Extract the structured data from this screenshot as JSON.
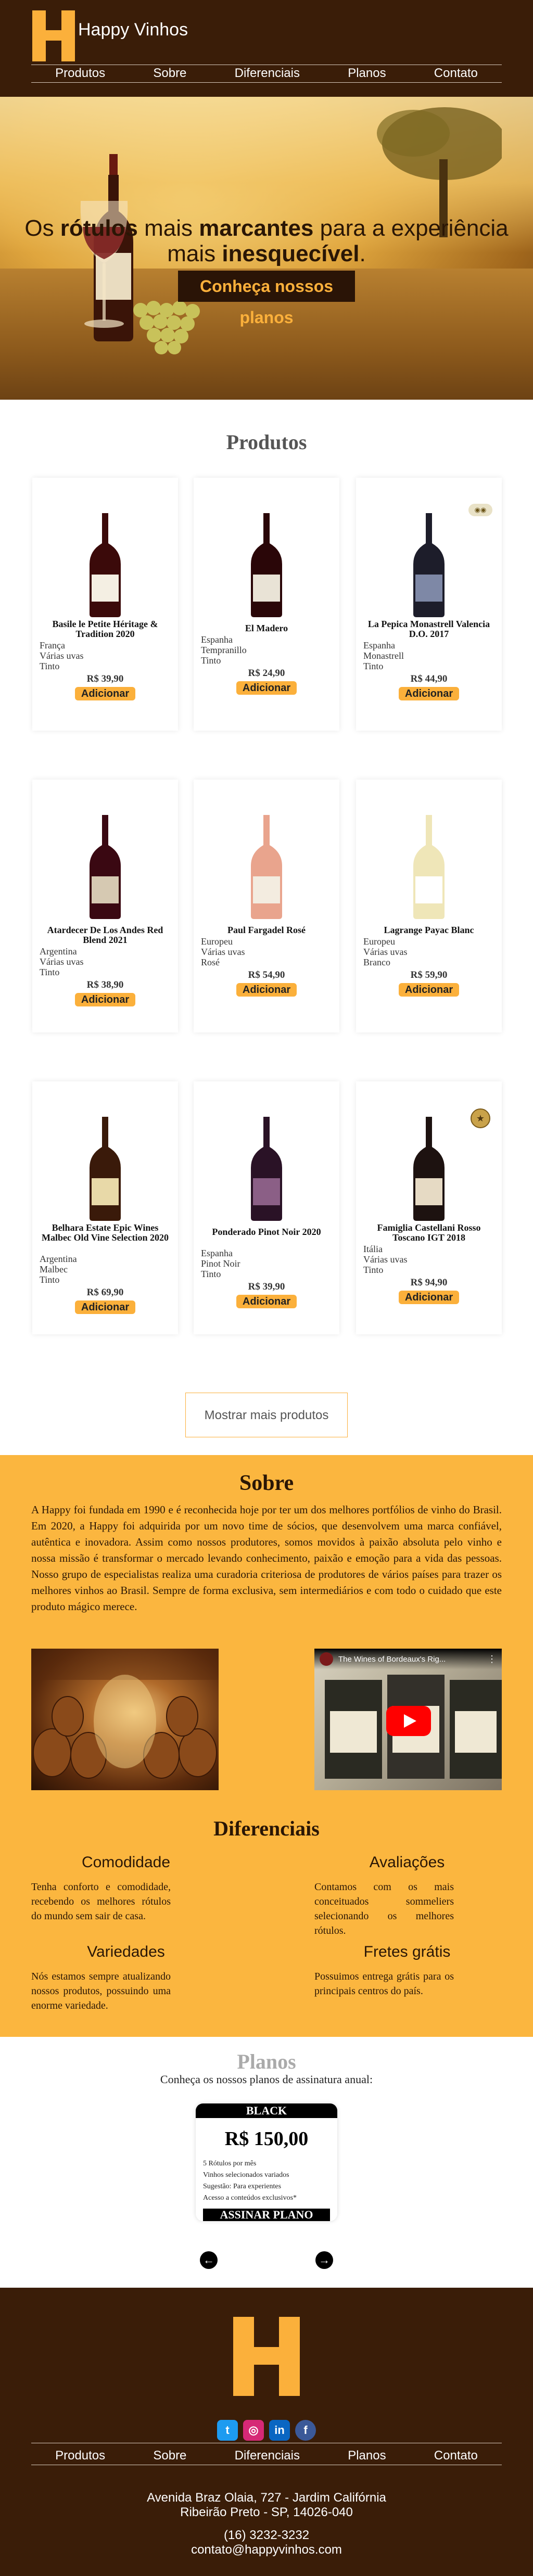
{
  "brand": {
    "name": "Happy Vinhos",
    "accent": "#fbb03b",
    "dark": "#3a1d08"
  },
  "nav": [
    "Produtos",
    "Sobre",
    "Diferenciais",
    "Planos",
    "Contato"
  ],
  "hero": {
    "line1_pre": "Os ",
    "line1_b1": "rótulos",
    "line1_mid": " mais ",
    "line1_b2": "marcantes",
    "line1_post": " para a experiência",
    "line2_pre": "mais ",
    "line2_b": "inesquecível",
    "line2_post": ".",
    "button": "Conheça nossos planos"
  },
  "products": {
    "title": "Produtos",
    "add_label": "Adicionar",
    "items": [
      {
        "name": "Basile le Petite Héritage & Tradition 2020",
        "country": "França",
        "grape": "Várias uvas",
        "type": "Tinto",
        "price": "R$ 39,90",
        "bottle": "#3b0a0a",
        "label": "#f4efe3"
      },
      {
        "name": "El Madero",
        "country": "Espanha",
        "grape": "Tempranillo",
        "type": "Tinto",
        "price": "R$ 24,90",
        "bottle": "#2a0608",
        "label": "#e9e3d6"
      },
      {
        "name": "La Pepica Monastrell Valencia D.O. 2017",
        "country": "Espanha",
        "grape": "Monastrell",
        "type": "Tinto",
        "price": "R$ 44,90",
        "bottle": "#1d1d2a",
        "label": "#7e88a6",
        "badge": "pill"
      },
      {
        "name": "Atardecer De Los Andes Red Blend 2021",
        "country": "Argentina",
        "grape": "Várias uvas",
        "type": "Tinto",
        "price": "R$ 38,90",
        "bottle": "#3a0812",
        "label": "#d6c9b2"
      },
      {
        "name": "Paul Fargadel Rosé",
        "country": "Europeu",
        "grape": "Várias uvas",
        "type": "Rosé",
        "price": "R$ 54,90",
        "bottle": "#e9a48d",
        "label": "#f3ece0"
      },
      {
        "name": "Lagrange Payac Blanc",
        "country": "Europeu",
        "grape": "Várias uvas",
        "type": "Branco",
        "price": "R$ 59,90",
        "bottle": "#efe6b8",
        "label": "#ffffff"
      },
      {
        "name": "Belhara Estate Epic Wines Malbec Old Vine Selection 2020",
        "country": "Argentina",
        "grape": "Malbec",
        "type": "Tinto",
        "price": "R$ 69,90",
        "bottle": "#3a1a0a",
        "label": "#e8d9a8"
      },
      {
        "name": "Ponderado Pinot Noir 2020",
        "country": "Espanha",
        "grape": "Pinot Noir",
        "type": "Tinto",
        "price": "R$ 39,90",
        "bottle": "#2a1226",
        "label": "#8b5f86"
      },
      {
        "name": "Famiglia Castellani Rosso Toscano IGT 2018",
        "country": "Itália",
        "grape": "Várias uvas",
        "type": "Tinto",
        "price": "R$ 94,90",
        "bottle": "#1d1210",
        "label": "#e6dac4",
        "badge": "medal"
      }
    ],
    "more_button": "Mostrar mais produtos"
  },
  "sobre": {
    "title": "Sobre",
    "text": "A Happy foi fundada em 1990 e é reconhecida hoje por ter um dos melhores portfólios de vinho do Brasil. Em 2020, a Happy foi adquirida por um novo time de sócios, que desenvolvem uma marca confiável, autêntica e inovadora. Assim como nossos produtores, somos movidos à paixão absoluta pelo vinho e nossa missão é transformar o mercado levando conhecimento, paixão e emoção para a vida das pessoas. Nosso grupo de especialistas realiza uma curadoria criteriosa de produtores de vários países para trazer os melhores vinhos ao Brasil. Sempre de forma exclusiva, sem intermediários e com todo o cuidado que este produto mágico merece.",
    "video_title": "The Wines of Bordeaux's Rig..."
  },
  "diferenciais": {
    "title": "Diferenciais",
    "items": [
      {
        "title": "Comodidade",
        "text": "Tenha conforto e comodidade, recebendo os melhores rótulos do mundo sem sair de casa."
      },
      {
        "title": "Avaliações",
        "text": "Contamos com os mais conceituados sommeliers selecionando os melhores rótulos."
      },
      {
        "title": "Variedades",
        "text": "Nós estamos sempre atualizando nossos produtos, possuindo uma enorme variedade."
      },
      {
        "title": "Fretes grátis",
        "text": "Possuimos entrega grátis para os principais centros do país."
      }
    ]
  },
  "planos": {
    "title": "Planos",
    "subtitle": "Conheça os nossos planos de assinatura anual:",
    "plan": {
      "name": "BLACK",
      "price": "R$ 150,00",
      "features": [
        "5 Rótulos por mês",
        "Vinhos selecionados variados",
        "Sugestão: Para experientes",
        "Acesso a conteúdos exclusivos*"
      ],
      "button": "ASSINAR PLANO"
    },
    "prev": "←",
    "next": "→"
  },
  "footer": {
    "address1": "Avenida Braz Olaia, 727 - Jardim Califórnia",
    "address2": "Ribeirão Preto - SP, 14026-040",
    "phone": "(16) 3232-3232",
    "email": "contato@happyvinhos.com",
    "social": [
      "twitter-icon",
      "instagram-icon",
      "linkedin-icon",
      "facebook-icon"
    ]
  }
}
